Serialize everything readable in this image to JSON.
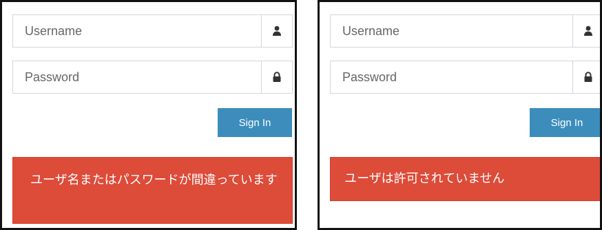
{
  "panels": [
    {
      "username_placeholder": "Username",
      "password_placeholder": "Password",
      "signin_label": "Sign In",
      "error_message": "ユーザ名またはパスワードが間違っています",
      "icons": {
        "username": "user-icon",
        "password": "lock-icon"
      }
    },
    {
      "username_placeholder": "Username",
      "password_placeholder": "Password",
      "signin_label": "Sign In",
      "error_message": "ユーザは許可されていません",
      "icons": {
        "username": "user-icon",
        "password": "lock-icon"
      }
    }
  ],
  "colors": {
    "primary_button": "#3c8dbc",
    "error_background": "#dd4b39",
    "icon": "#333333"
  }
}
